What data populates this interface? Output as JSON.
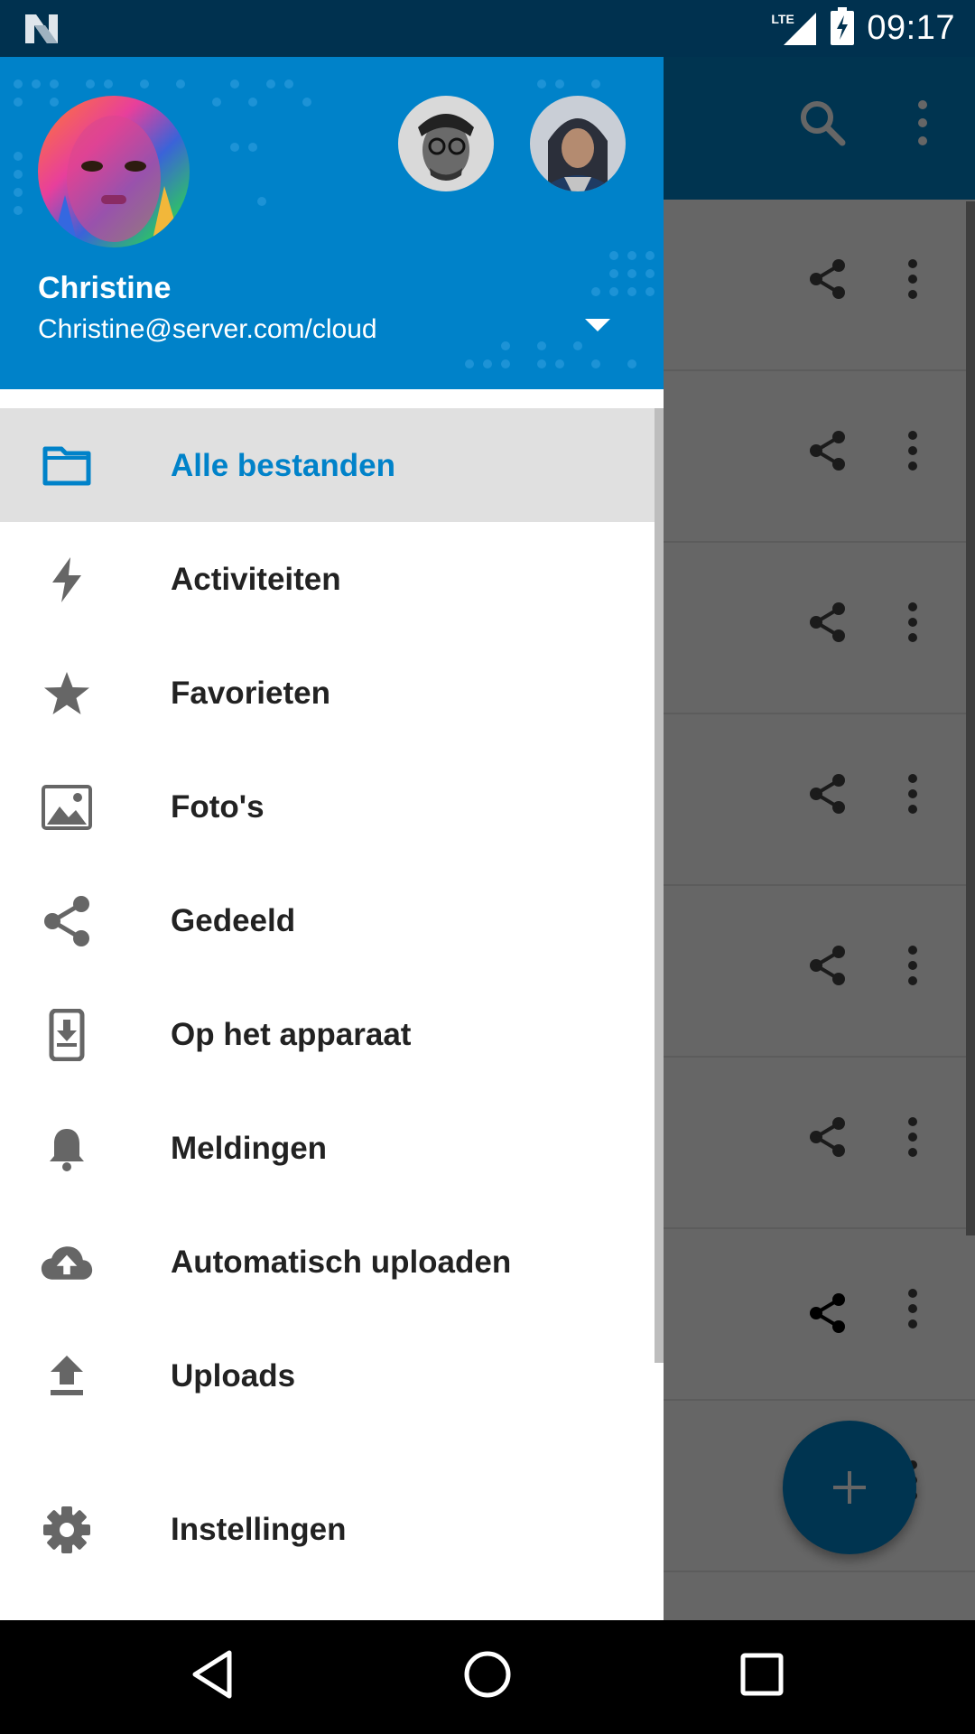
{
  "status_bar": {
    "time": "09:17",
    "network": "LTE",
    "icons": [
      "n-logo-icon",
      "signal-icon",
      "battery-charging-icon"
    ]
  },
  "background": {
    "toolbar_icons": [
      "search-icon",
      "more-vert-icon"
    ],
    "row_count": 8,
    "fab_icon": "plus-icon"
  },
  "drawer": {
    "header": {
      "name": "Christine",
      "email": "Christine@server.com/cloud"
    },
    "items": [
      {
        "label": "Alle bestanden",
        "icon": "folder-icon",
        "active": true
      },
      {
        "label": "Activiteiten",
        "icon": "flash-icon"
      },
      {
        "label": "Favorieten",
        "icon": "star-icon"
      },
      {
        "label": "Foto's",
        "icon": "image-icon"
      },
      {
        "label": "Gedeeld",
        "icon": "share-icon"
      },
      {
        "label": "Op het apparaat",
        "icon": "phone-download-icon"
      },
      {
        "label": "Meldingen",
        "icon": "bell-icon"
      },
      {
        "label": "Automatisch uploaden",
        "icon": "cloud-upload-icon"
      },
      {
        "label": "Uploads",
        "icon": "upload-icon"
      },
      {
        "label": "Instellingen",
        "icon": "gear-icon"
      }
    ]
  },
  "colors": {
    "accent": "#0082c9",
    "status_bar": "#00314f",
    "active_bg": "#e0e0e0"
  },
  "navigation_bar": {
    "buttons": [
      "back-icon",
      "home-icon",
      "recents-icon"
    ]
  }
}
